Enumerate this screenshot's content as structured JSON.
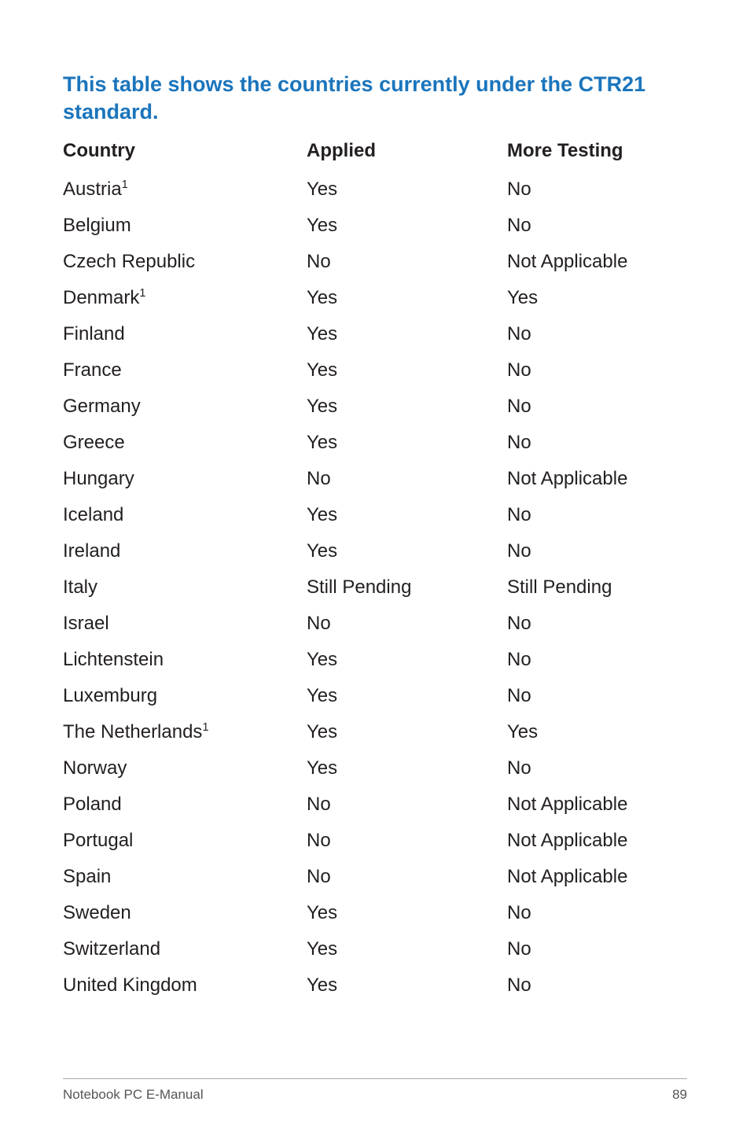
{
  "title": "This table shows the countries currently under the CTR21 standard.",
  "headers": {
    "country": "Country",
    "applied": "Applied",
    "testing": "More Testing"
  },
  "rows": [
    {
      "country": "Austria",
      "sup": "1",
      "applied": "Yes",
      "testing": "No"
    },
    {
      "country": "Belgium",
      "sup": "",
      "applied": "Yes",
      "testing": "No"
    },
    {
      "country": "Czech Republic",
      "sup": "",
      "applied": "No",
      "testing": "Not Applicable"
    },
    {
      "country": "Denmark",
      "sup": "1",
      "applied": "Yes",
      "testing": "Yes"
    },
    {
      "country": "Finland",
      "sup": "",
      "applied": "Yes",
      "testing": "No"
    },
    {
      "country": "France",
      "sup": "",
      "applied": "Yes",
      "testing": "No"
    },
    {
      "country": "Germany",
      "sup": "",
      "applied": "Yes",
      "testing": "No"
    },
    {
      "country": "Greece",
      "sup": "",
      "applied": "Yes",
      "testing": "No"
    },
    {
      "country": "Hungary",
      "sup": "",
      "applied": "No",
      "testing": "Not Applicable"
    },
    {
      "country": "Iceland",
      "sup": "",
      "applied": "Yes",
      "testing": "No"
    },
    {
      "country": "Ireland",
      "sup": "",
      "applied": "Yes",
      "testing": "No"
    },
    {
      "country": "Italy",
      "sup": "",
      "applied": "Still Pending",
      "testing": "Still Pending"
    },
    {
      "country": "Israel",
      "sup": "",
      "applied": "No",
      "testing": "No"
    },
    {
      "country": "Lichtenstein",
      "sup": "",
      "applied": "Yes",
      "testing": "No"
    },
    {
      "country": "Luxemburg",
      "sup": "",
      "applied": "Yes",
      "testing": "No"
    },
    {
      "country": "The Netherlands",
      "sup": "1",
      "applied": "Yes",
      "testing": "Yes"
    },
    {
      "country": "Norway",
      "sup": "",
      "applied": "Yes",
      "testing": "No"
    },
    {
      "country": "Poland",
      "sup": "",
      "applied": "No",
      "testing": "Not Applicable"
    },
    {
      "country": "Portugal",
      "sup": "",
      "applied": "No",
      "testing": "Not Applicable"
    },
    {
      "country": "Spain",
      "sup": "",
      "applied": "No",
      "testing": "Not Applicable"
    },
    {
      "country": "Sweden",
      "sup": "",
      "applied": "Yes",
      "testing": "No"
    },
    {
      "country": "Switzerland",
      "sup": "",
      "applied": "Yes",
      "testing": "No"
    },
    {
      "country": "United Kingdom",
      "sup": "",
      "applied": "Yes",
      "testing": "No"
    }
  ],
  "footer": {
    "left": "Notebook PC E-Manual",
    "right": "89"
  }
}
